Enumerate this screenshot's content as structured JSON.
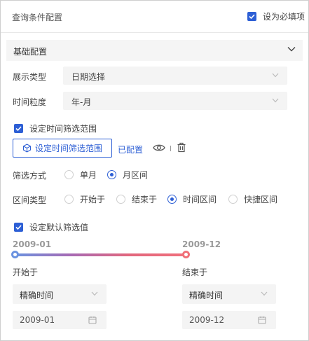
{
  "header": {
    "title": "查询条件配置",
    "required_label": "设为必填项",
    "required_checked": true
  },
  "section": {
    "title": "基础配置"
  },
  "display_type": {
    "label": "展示类型",
    "value": "日期选择"
  },
  "granularity": {
    "label": "时间粒度",
    "value": "年-月"
  },
  "time_range": {
    "checkbox_label": "设定时间筛选范围",
    "checked": true,
    "button_label": "设定时间筛选范围",
    "configured_label": "已配置"
  },
  "filter_mode": {
    "label": "筛选方式",
    "options": [
      {
        "label": "单月",
        "selected": false
      },
      {
        "label": "月区间",
        "selected": true
      }
    ]
  },
  "interval_type": {
    "label": "区间类型",
    "options": [
      {
        "label": "开始于",
        "selected": false
      },
      {
        "label": "结束于",
        "selected": false
      },
      {
        "label": "时间区间",
        "selected": true
      },
      {
        "label": "快捷区间",
        "selected": false
      }
    ]
  },
  "default_filter": {
    "checkbox_label": "设定默认筛选值",
    "checked": true,
    "range_start": "2009-01",
    "range_end": "2009-12",
    "start": {
      "label": "开始于",
      "mode": "精确时间",
      "date": "2009-01"
    },
    "end": {
      "label": "结束于",
      "mode": "精确时间",
      "date": "2009-12"
    }
  },
  "colors": {
    "accent": "#2d5fd5",
    "slider_start": "#6b93e0",
    "slider_end": "#f07078"
  }
}
